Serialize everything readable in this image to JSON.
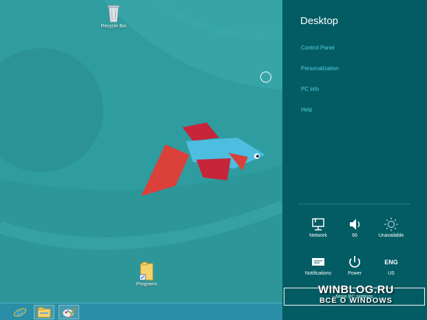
{
  "desktop": {
    "icons": [
      {
        "name": "recycle-bin",
        "label": "Recycle Bin"
      },
      {
        "name": "programs",
        "label": "Programs"
      }
    ]
  },
  "taskbar": {
    "buttons": [
      {
        "name": "internet-explorer",
        "icon": "ie-icon"
      },
      {
        "name": "file-explorer",
        "icon": "folder-icon"
      },
      {
        "name": "paint",
        "icon": "paint-icon"
      }
    ]
  },
  "charm": {
    "title": "Desktop",
    "links": [
      "Control Panel",
      "Personalization",
      "PC info",
      "Help"
    ],
    "tiles": [
      {
        "icon": "network-icon",
        "label": "Network"
      },
      {
        "icon": "volume-icon",
        "label": "66"
      },
      {
        "icon": "brightness-icon",
        "label": "Unavailable"
      },
      {
        "icon": "notifications-icon",
        "label": "Notifications"
      },
      {
        "icon": "power-icon",
        "label": "Power"
      },
      {
        "text": "ENG",
        "label": "US"
      }
    ],
    "change_settings": "More PC settings"
  },
  "watermark": {
    "line1": "WINBLOG.RU",
    "line2": "ВСЁ О WINDOWS"
  },
  "colors": {
    "charm_bg": "#035c64",
    "link": "#55d0e0",
    "desktop": "#2f9c9f"
  }
}
